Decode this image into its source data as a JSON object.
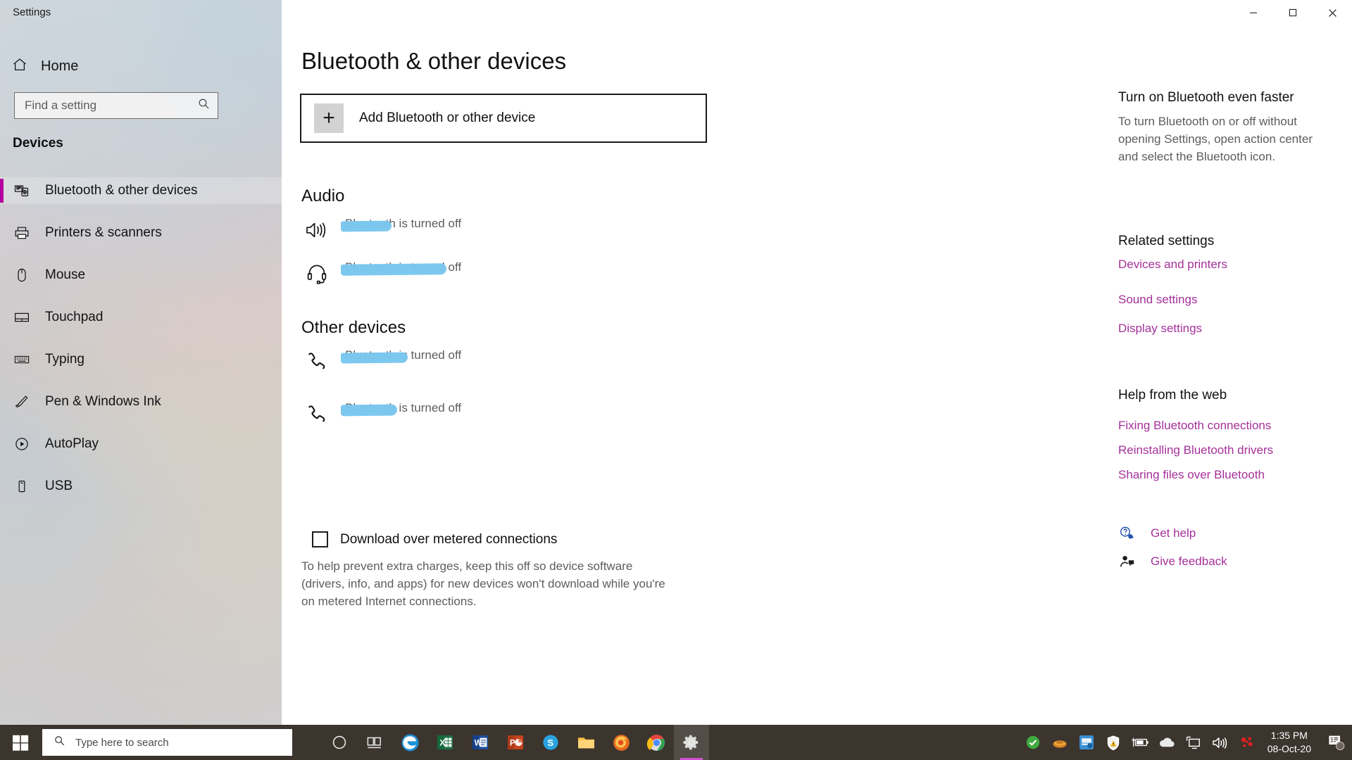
{
  "window": {
    "title": "Settings",
    "controls": {
      "minimize": "minimize-button",
      "maximize": "maximize-button",
      "close": "close-button"
    }
  },
  "sidebar": {
    "home_label": "Home",
    "search_placeholder": "Find a setting",
    "category": "Devices",
    "items": [
      {
        "label": "Bluetooth & other devices",
        "icon": "bluetooth-devices-icon",
        "selected": true
      },
      {
        "label": "Printers & scanners",
        "icon": "printer-icon",
        "selected": false
      },
      {
        "label": "Mouse",
        "icon": "mouse-icon",
        "selected": false
      },
      {
        "label": "Touchpad",
        "icon": "touchpad-icon",
        "selected": false
      },
      {
        "label": "Typing",
        "icon": "keyboard-icon",
        "selected": false
      },
      {
        "label": "Pen & Windows Ink",
        "icon": "pen-icon",
        "selected": false
      },
      {
        "label": "AutoPlay",
        "icon": "autoplay-icon",
        "selected": false
      },
      {
        "label": "USB",
        "icon": "usb-icon",
        "selected": false
      }
    ],
    "accent_color": "#b4009e"
  },
  "main": {
    "page_title": "Bluetooth & other devices",
    "add_device_label": "Add Bluetooth or other device",
    "sections": [
      {
        "title": "Audio",
        "devices": [
          {
            "name": "",
            "status": "Bluetooth is turned off",
            "icon": "speaker-icon",
            "redacted": true,
            "redact_width": 72
          },
          {
            "name": "",
            "status": "Bluetooth is turned off",
            "icon": "headset-icon",
            "redacted": true,
            "redact_width": 150
          }
        ]
      },
      {
        "title": "Other devices",
        "devices": [
          {
            "name": "",
            "status": "Bluetooth is turned off",
            "icon": "phone-icon",
            "redacted": true,
            "redact_width": 95
          },
          {
            "name": "",
            "status": "Bluetooth is turned off",
            "icon": "phone-icon",
            "redacted": true,
            "redact_width": 80
          }
        ]
      }
    ],
    "metered": {
      "checkbox_label": "Download over metered connections",
      "checked": false,
      "description": "To help prevent extra charges, keep this off so device software (drivers, info, and apps) for new devices won't download while you're on metered Internet connections."
    },
    "redaction_color": "#79c6ee"
  },
  "right_panel": {
    "tip_title": "Turn on Bluetooth even faster",
    "tip_body": "To turn Bluetooth on or off without opening Settings, open action center and select the Bluetooth icon.",
    "related_title": "Related settings",
    "related_links": [
      "Devices and printers",
      "Sound settings",
      "Display settings"
    ],
    "help_title": "Help from the web",
    "help_links": [
      "Fixing Bluetooth connections",
      "Reinstalling Bluetooth drivers",
      "Sharing files over Bluetooth"
    ],
    "get_help": "Get help",
    "give_feedback": "Give feedback",
    "link_color": "#a4309a"
  },
  "taskbar": {
    "search_placeholder": "Type here to search",
    "apps": [
      {
        "name": "cortana-icon"
      },
      {
        "name": "task-view-icon"
      },
      {
        "name": "edge-icon"
      },
      {
        "name": "excel-icon"
      },
      {
        "name": "word-icon"
      },
      {
        "name": "powerpoint-icon"
      },
      {
        "name": "skype-icon"
      },
      {
        "name": "file-explorer-icon"
      },
      {
        "name": "firefox-icon"
      },
      {
        "name": "chrome-icon"
      },
      {
        "name": "settings-icon",
        "active": true
      }
    ],
    "tray": [
      {
        "name": "green-check-icon"
      },
      {
        "name": "onedrive-orange-icon"
      },
      {
        "name": "blue-app-icon"
      },
      {
        "name": "security-warning-icon"
      },
      {
        "name": "battery-charging-icon"
      },
      {
        "name": "onedrive-cloud-icon"
      },
      {
        "name": "display-icon"
      },
      {
        "name": "volume-icon"
      },
      {
        "name": "red-molecule-icon"
      }
    ],
    "time": "1:35 PM",
    "date": "08-Oct-20",
    "notification_count": "1"
  }
}
